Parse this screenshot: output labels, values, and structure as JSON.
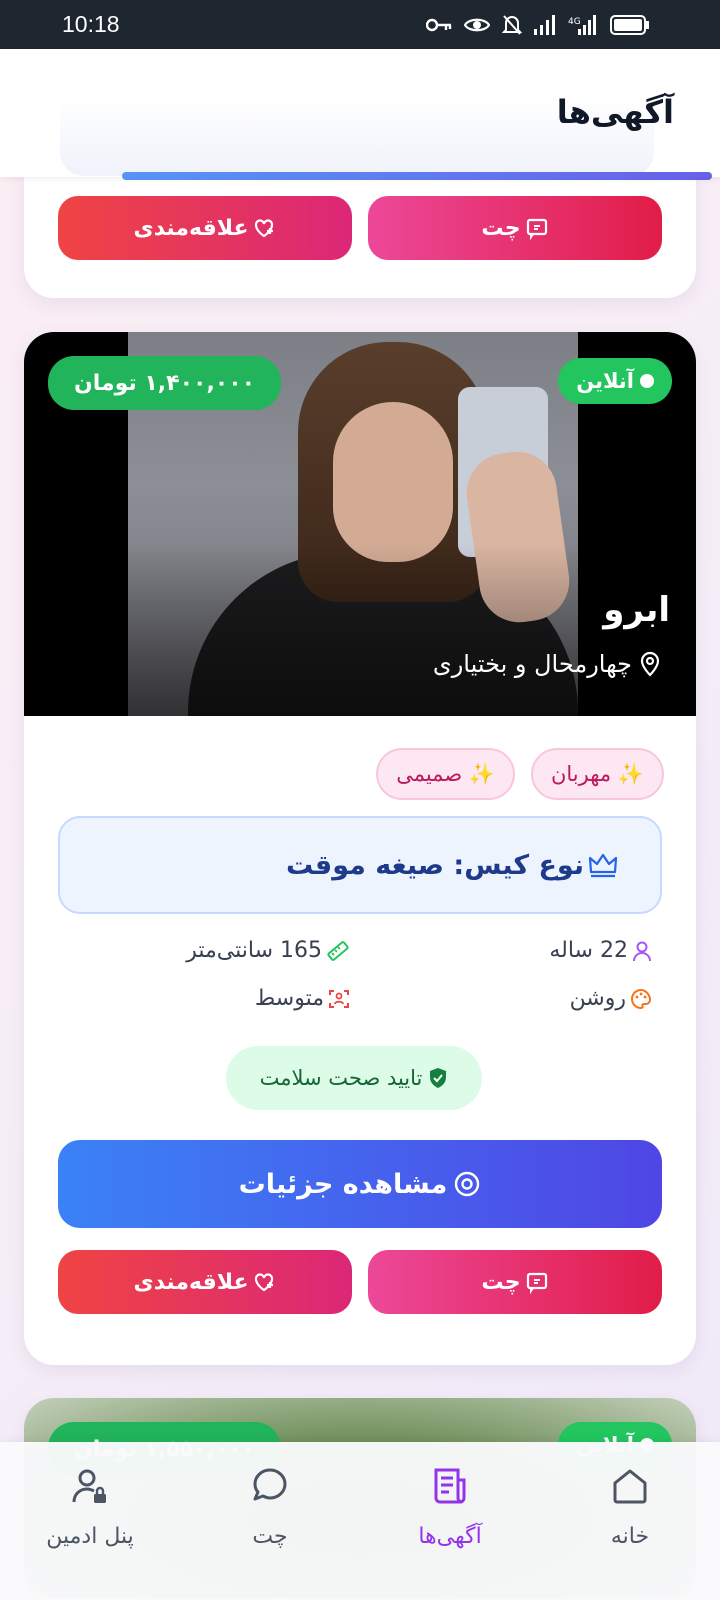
{
  "status_bar": {
    "time": "10:18",
    "icons": [
      "key-icon",
      "eye-icon",
      "bell-off-icon",
      "signal-icon",
      "signal-4g-icon",
      "battery-icon"
    ]
  },
  "header": {
    "title": "آگهی‌ها"
  },
  "prev_card": {
    "chat_label": "چت",
    "favorite_label": "علاقه‌مندی"
  },
  "listing": {
    "status": "آنلاین",
    "price": "۱,۴۰۰,۰۰۰ تومان",
    "name": "ابرو",
    "location": "چهارمحال و بختیاری",
    "tags": [
      "✨ مهربان",
      "✨ صمیمی"
    ],
    "case_type": "نوع کیس: صیغه موقت",
    "age": "22 ساله",
    "height": "165 سانتی‌متر",
    "skin": "روشن",
    "body": "متوسط",
    "health": "تایید صحت سلامت",
    "details_label": "مشاهده جزئیات",
    "chat_label": "چت",
    "favorite_label": "علاقه‌مندی"
  },
  "next_card": {
    "status": "آنلاین",
    "price": "۱,۵۵۰,۰۰۰ تومان"
  },
  "bottom_nav": {
    "items": [
      {
        "label": "خانه",
        "icon": "home-icon"
      },
      {
        "label": "آگهی‌ها",
        "icon": "listings-icon",
        "active": true
      },
      {
        "label": "چت",
        "icon": "chat-icon"
      },
      {
        "label": "پنل ادمین",
        "icon": "admin-icon"
      }
    ]
  },
  "colors": {
    "accent": "#9333ea",
    "online": "#22c55e",
    "primary_button": "#3b82f6",
    "chat_button": "#ec4899",
    "favorite_button": "#ef4444"
  }
}
